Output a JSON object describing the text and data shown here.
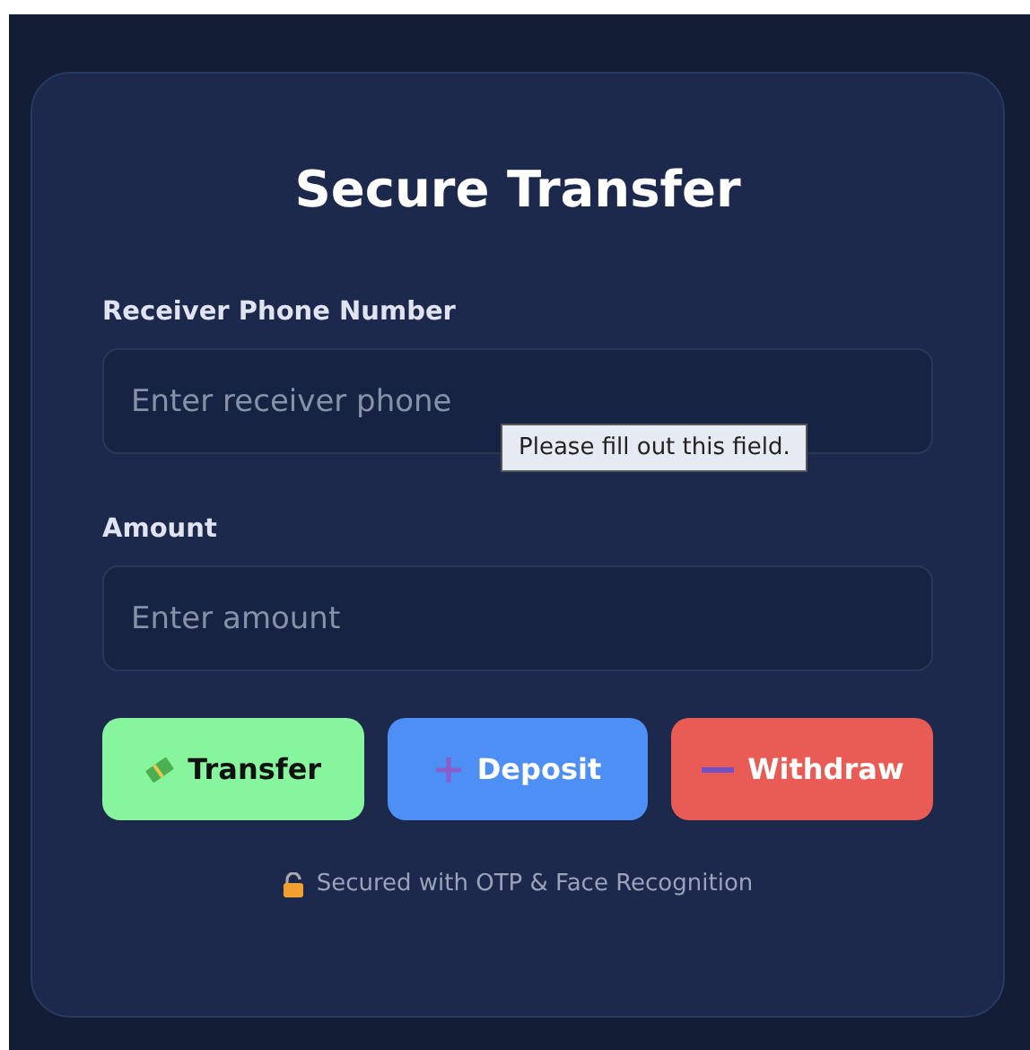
{
  "title": "Secure Transfer",
  "fields": [
    {
      "label": "Receiver Phone Number",
      "placeholder": "Enter receiver phone",
      "tooltip": "Please fill out this field."
    },
    {
      "label": "Amount",
      "placeholder": "Enter amount"
    }
  ],
  "buttons": [
    {
      "kind": "transfer",
      "label": "Transfer"
    },
    {
      "kind": "deposit",
      "label": "Deposit"
    },
    {
      "kind": "withdraw",
      "label": "Withdraw"
    }
  ],
  "footer": "Secured with OTP & Face Recognition"
}
